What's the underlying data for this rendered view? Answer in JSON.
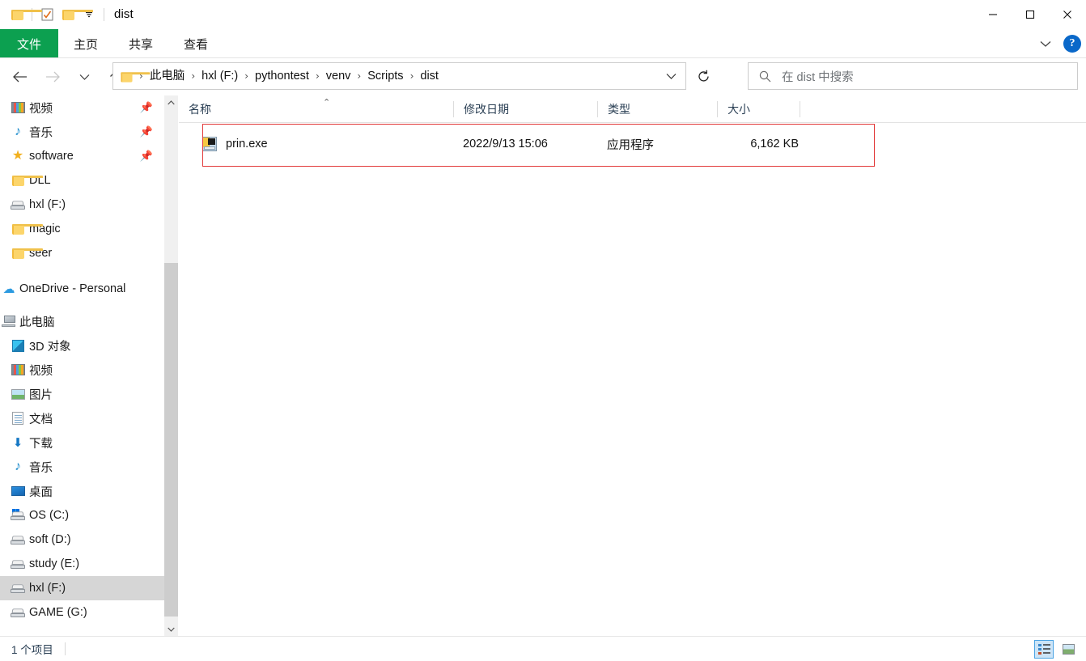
{
  "window": {
    "title": "dist",
    "quick_access": [
      "folder-icon",
      "properties-icon",
      "new-folder-icon",
      "customize-chevron"
    ],
    "controls": {
      "minimize": "–",
      "maximize": "☐",
      "close": "✕"
    }
  },
  "ribbon": {
    "tabs": [
      {
        "label": "文件",
        "active": true
      },
      {
        "label": "主页",
        "active": false
      },
      {
        "label": "共享",
        "active": false
      },
      {
        "label": "查看",
        "active": false
      }
    ],
    "expand_icon": "chevron-down-icon",
    "help_label": "?",
    "accent_green": "#0ca050",
    "help_blue": "#0a68c9"
  },
  "navigation": {
    "back": "←",
    "forward": "→",
    "history": "⌄",
    "up": "↑",
    "refresh": "↻",
    "breadcrumb": [
      "此电脑",
      "hxl (F:)",
      "pythontest",
      "venv",
      "Scripts",
      "dist"
    ],
    "breadcrumb_separator": "›",
    "address_chevron": "⌄"
  },
  "search": {
    "placeholder": "在 dist 中搜索",
    "icon": "search-icon"
  },
  "sidebar": {
    "quick_access": [
      {
        "label": "视频",
        "icon": "video-icon",
        "pinned": true
      },
      {
        "label": "音乐",
        "icon": "music-icon",
        "pinned": true
      },
      {
        "label": "software",
        "icon": "star-icon",
        "pinned": true
      },
      {
        "label": "DLL",
        "icon": "folder-icon",
        "pinned": false
      },
      {
        "label": "hxl (F:)",
        "icon": "drive-icon",
        "pinned": false
      },
      {
        "label": "magic",
        "icon": "folder-icon",
        "pinned": false
      },
      {
        "label": "seer",
        "icon": "folder-icon",
        "pinned": false
      }
    ],
    "onedrive": {
      "label": "OneDrive - Personal",
      "icon": "cloud-icon"
    },
    "this_pc": {
      "label": "此电脑",
      "icon": "pc-icon"
    },
    "this_pc_children": [
      {
        "label": "3D 对象",
        "icon": "cube-3d-icon"
      },
      {
        "label": "视频",
        "icon": "video-icon"
      },
      {
        "label": "图片",
        "icon": "pictures-icon"
      },
      {
        "label": "文档",
        "icon": "documents-icon"
      },
      {
        "label": "下载",
        "icon": "downloads-icon"
      },
      {
        "label": "音乐",
        "icon": "music-icon"
      },
      {
        "label": "桌面",
        "icon": "desktop-icon"
      },
      {
        "label": "OS (C:)",
        "icon": "os-drive-icon"
      },
      {
        "label": "soft (D:)",
        "icon": "drive-icon"
      },
      {
        "label": "study (E:)",
        "icon": "drive-icon"
      },
      {
        "label": "hxl (F:)",
        "icon": "drive-icon",
        "selected": true
      },
      {
        "label": "GAME (G:)",
        "icon": "drive-icon"
      }
    ],
    "scrollbar": {
      "up_arrow": "⌃",
      "down_arrow": "⌄"
    }
  },
  "file_list": {
    "columns": [
      {
        "label": "名称",
        "sorted": true,
        "sort_arrow": "⌃"
      },
      {
        "label": "修改日期"
      },
      {
        "label": "类型"
      },
      {
        "label": "大小"
      }
    ],
    "rows": [
      {
        "name": "prin.exe",
        "date": "2022/9/13 15:06",
        "type": "应用程序",
        "size": "6,162 KB",
        "icon": "exe-file-icon"
      }
    ],
    "highlight_color": "#e23a3a"
  },
  "status": {
    "item_count": "1 个项目",
    "view_details": "details-view-icon",
    "view_thumbnails": "thumbnail-view-icon",
    "active_view": "details"
  }
}
